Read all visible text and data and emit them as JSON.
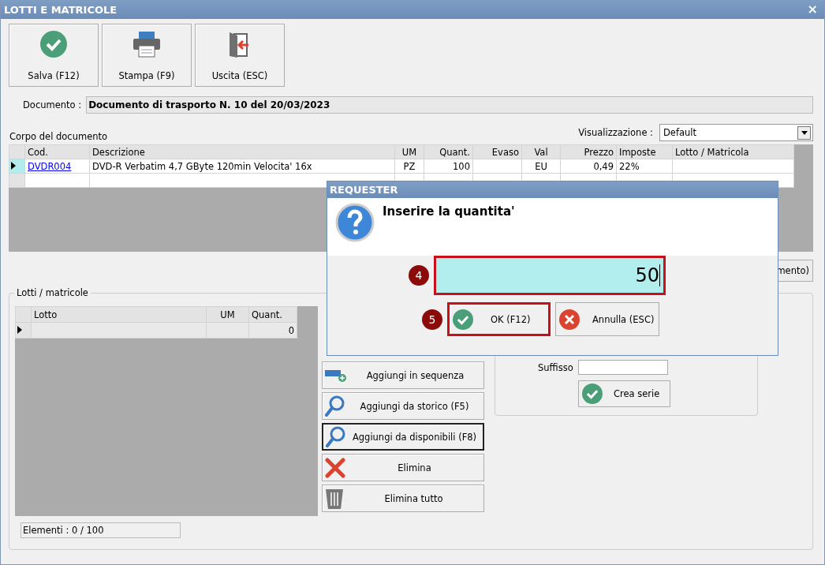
{
  "window": {
    "title": "LOTTI E MATRICOLE",
    "close": "×"
  },
  "toolbar": [
    {
      "label": "Salva (F12)",
      "kind": "save"
    },
    {
      "label": "Stampa (F9)",
      "kind": "print"
    },
    {
      "label": "Uscita (ESC)",
      "kind": "exit"
    }
  ],
  "document": {
    "label": "Documento :",
    "value": "Documento di trasporto N. 10 del 20/03/2023"
  },
  "body": {
    "title": "Corpo del documento",
    "view_label": "Visualizzazione :",
    "view_value": "Default",
    "columns": [
      "Cod.",
      "Descrizione",
      "UM",
      "Quant.",
      "Evaso",
      "Val",
      "Prezzo",
      "Imposte",
      "Lotto / Matricola"
    ],
    "rows": [
      {
        "selected": true,
        "cells": [
          "DVDR004",
          "DVD-R Verbatim 4,7 GByte 120min  Velocita' 16x",
          "PZ",
          "100",
          "",
          "EU",
          "0,49",
          "22%",
          ""
        ]
      }
    ]
  },
  "partial_button": {
    "label": "mento)"
  },
  "lots": {
    "title": "Lotti / matricole",
    "columns": [
      "Lotto",
      "UM",
      "Quant."
    ],
    "rows": [
      {
        "selected": true,
        "quantity": "0"
      }
    ],
    "counter": "Elementi : 0 / 100"
  },
  "actions": [
    {
      "label": "Aggiungi in sequenza",
      "kind": "add",
      "focused": false
    },
    {
      "label": "Aggiungi da storico (F5)",
      "kind": "search",
      "focused": false
    },
    {
      "label": "Aggiungi da disponibili (F8)",
      "kind": "search",
      "focused": true
    },
    {
      "label": "Elimina",
      "kind": "delete",
      "focused": false
    },
    {
      "label": "Elimina tutto",
      "kind": "trash",
      "focused": false
    }
  ],
  "series": {
    "suffix_label": "Suffisso",
    "create_label": "Crea serie"
  },
  "dialog": {
    "title": "REQUESTER",
    "prompt": "Inserire la quantita'",
    "value": "50",
    "ok": "OK (F12)",
    "cancel": "Annulla (ESC)",
    "markers": [
      "4",
      "5"
    ]
  }
}
